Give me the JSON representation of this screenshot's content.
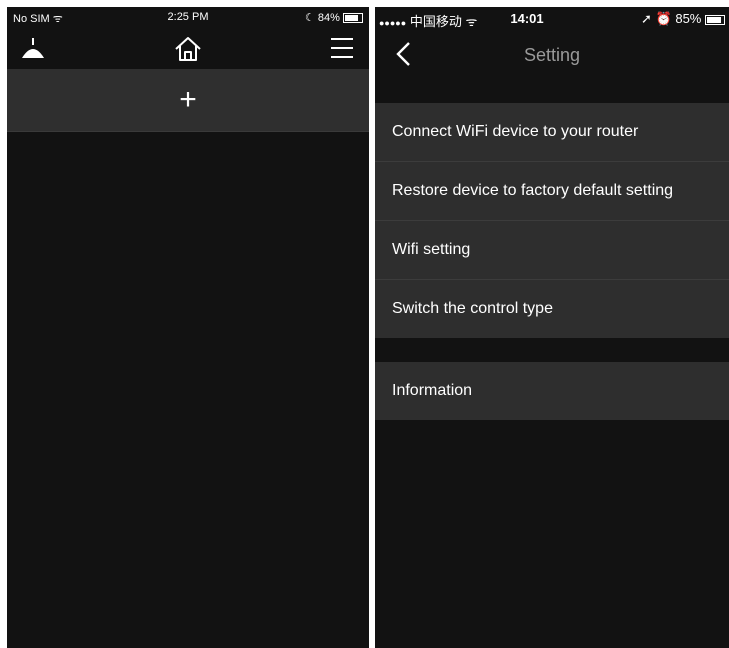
{
  "left": {
    "status": {
      "carrier": "No SIM",
      "wifi_icon": "ᯤ",
      "time": "2:25 PM",
      "moon_icon": "☾",
      "battery": "84%",
      "battery_level": 0.84
    },
    "add_label": "+"
  },
  "right": {
    "status": {
      "signal": "●●●●●",
      "carrier": "中国移动",
      "wifi_icon": "ᯤ",
      "time": "14:01",
      "location_icon": "➚",
      "alarm_icon": "⏰",
      "battery": "85%",
      "battery_level": 0.85
    },
    "title": "Setting",
    "settings_items": [
      "Connect WiFi device to your router",
      "Restore device to factory default setting",
      "Wifi setting",
      "Switch the control type"
    ],
    "info_items": [
      "Information"
    ]
  }
}
